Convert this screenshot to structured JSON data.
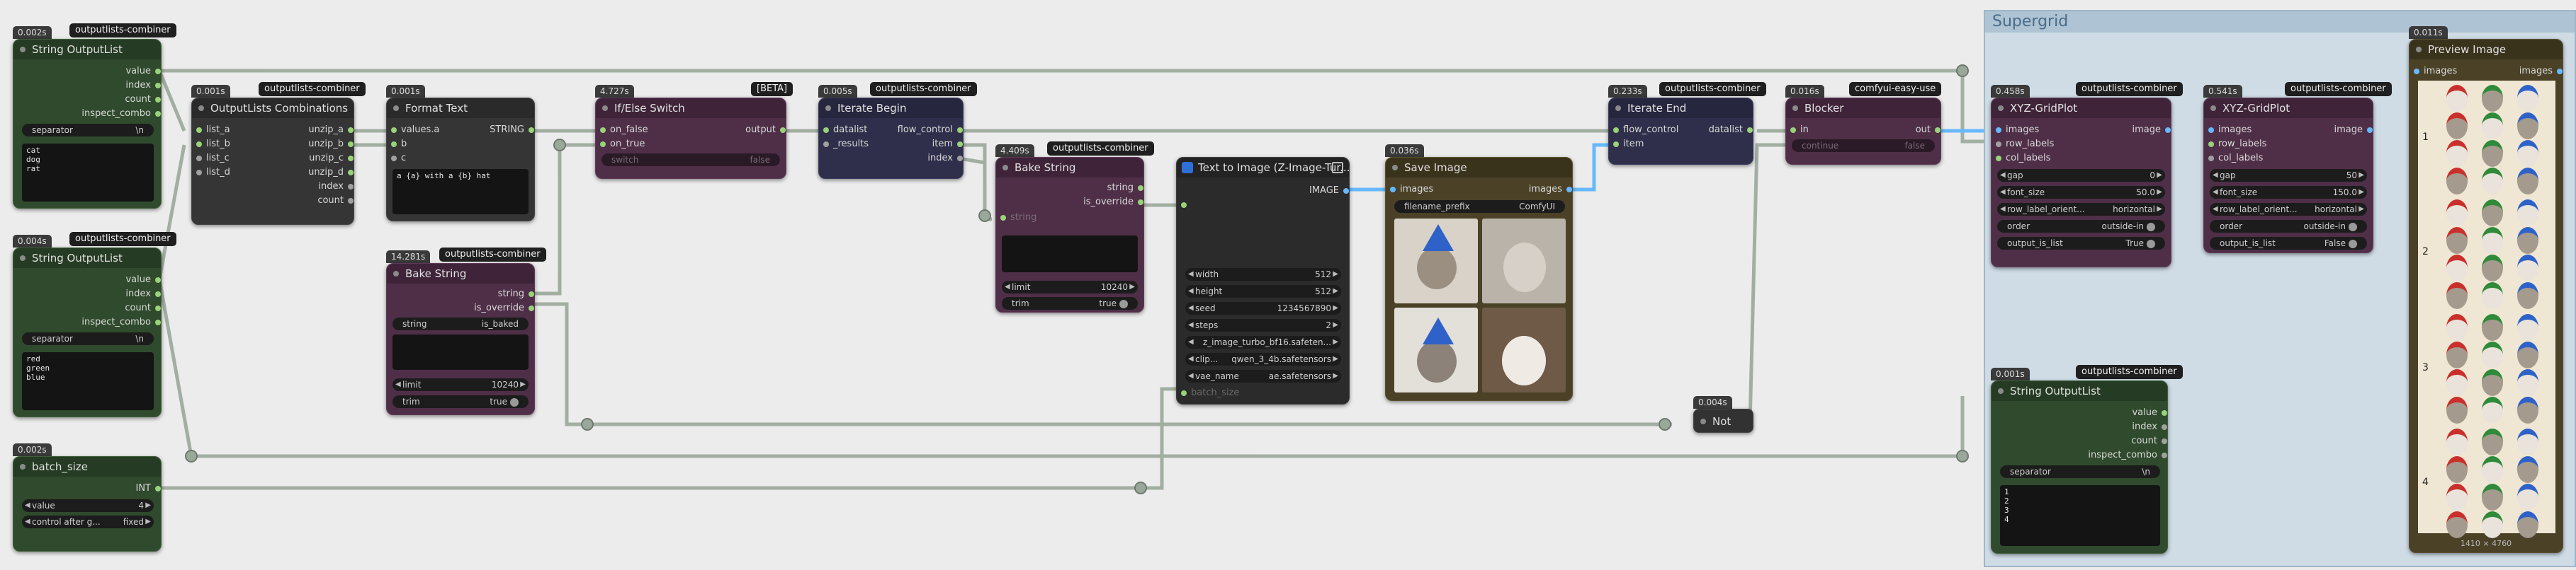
{
  "supergrid": {
    "title": "Supergrid"
  },
  "nodes": {
    "string1": {
      "time": "0.002s",
      "source": "outputlists-combiner",
      "title": "String OutputList",
      "outputs": [
        "value",
        "index",
        "count",
        "inspect_combo"
      ],
      "separator_label": "separator",
      "separator_value": "\\n",
      "text": "cat\ndog\nrat"
    },
    "string2": {
      "time": "0.004s",
      "source": "outputlists-combiner",
      "title": "String OutputList",
      "outputs": [
        "value",
        "index",
        "count",
        "inspect_combo"
      ],
      "separator_label": "separator",
      "separator_value": "\\n",
      "text": "red\ngreen\nblue"
    },
    "batch": {
      "time": "0.002s",
      "title": "batch_size",
      "output": "INT",
      "value_label": "value",
      "value": "4",
      "control_label": "control after g...",
      "control_value": "fixed"
    },
    "combos": {
      "time": "0.001s",
      "source": "outputlists-combiner",
      "title": "OutputLists Combinations",
      "inputs": [
        "list_a",
        "list_b",
        "list_c",
        "list_d"
      ],
      "outputs": [
        "unzip_a",
        "unzip_b",
        "unzip_c",
        "unzip_d",
        "index",
        "count"
      ]
    },
    "format": {
      "time": "0.001s",
      "title": "Format Text",
      "inputs": [
        "values.a",
        "b",
        "c"
      ],
      "output": "STRING",
      "template": "a {a} with a {b} hat"
    },
    "bake1": {
      "time": "14.281s",
      "source": "outputlists-combiner",
      "title": "Bake String",
      "outputs": [
        "string",
        "is_override"
      ],
      "string_label": "string",
      "string_value": "is_baked",
      "limit_label": "limit",
      "limit_value": "10240",
      "trim_label": "trim",
      "trim_value": "true"
    },
    "ifelse": {
      "time": "4.727s",
      "source": "[BETA]",
      "title": "If/Else Switch",
      "inputs": [
        "on_false",
        "on_true",
        "switch"
      ],
      "output": "output",
      "switch_value": "false"
    },
    "iterbegin": {
      "time": "0.005s",
      "source": "outputlists-combiner",
      "title": "Iterate Begin",
      "inputs": [
        "datalist",
        "_results"
      ],
      "outputs": [
        "flow_control",
        "item",
        "index"
      ]
    },
    "bake2": {
      "time": "4.409s",
      "source": "outputlists-combiner",
      "title": "Bake String",
      "outputs": [
        "string",
        "is_override"
      ],
      "string_label": "string",
      "limit_label": "limit",
      "limit_value": "10240",
      "trim_label": "trim",
      "trim_value": "true"
    },
    "t2i": {
      "title": "Text to Image (Z-Image-Tur...",
      "output": "IMAGE",
      "fields": [
        {
          "label": "width",
          "value": "512"
        },
        {
          "label": "height",
          "value": "512"
        },
        {
          "label": "seed",
          "value": "1234567890"
        },
        {
          "label": "steps",
          "value": "2"
        },
        {
          "label": "",
          "value": "z_image_turbo_bf16.safeten..."
        },
        {
          "label": "clip...",
          "value": "qwen_3_4b.safetensors"
        },
        {
          "label": "vae_name",
          "value": "ae.safetensors"
        }
      ],
      "batch_label": "batch_size"
    },
    "save": {
      "time": "0.036s",
      "title": "Save Image",
      "input": "images",
      "output": "images",
      "prefix_label": "filename_prefix",
      "prefix_value": "ComfyUI"
    },
    "not": {
      "time": "0.004s",
      "title": "Not"
    },
    "iterend": {
      "time": "0.233s",
      "source": "outputlists-combiner",
      "title": "Iterate End",
      "inputs": [
        "flow_control",
        "item"
      ],
      "output": "datalist"
    },
    "blocker": {
      "time": "0.016s",
      "source": "comfyui-easy-use",
      "title": "Blocker",
      "input": "in",
      "output": "out",
      "continue_label": "continue",
      "continue_value": "false"
    },
    "xyz1": {
      "time": "0.458s",
      "source": "outputlists-combiner",
      "title": "XYZ-GridPlot",
      "inputs": [
        "images",
        "row_labels",
        "col_labels"
      ],
      "output": "image",
      "fields": [
        {
          "label": "gap",
          "value": "0"
        },
        {
          "label": "font_size",
          "value": "50.0"
        },
        {
          "label": "row_label_orient...",
          "value": "horizontal"
        },
        {
          "label": "order",
          "value": "outside-in"
        },
        {
          "label": "output_is_list",
          "value": "True"
        }
      ]
    },
    "xyz2": {
      "time": "0.541s",
      "source": "outputlists-combiner",
      "title": "XYZ-GridPlot",
      "inputs": [
        "images",
        "row_labels",
        "col_labels"
      ],
      "output": "image",
      "fields": [
        {
          "label": "gap",
          "value": "50"
        },
        {
          "label": "font_size",
          "value": "150.0"
        },
        {
          "label": "row_label_orient...",
          "value": "horizontal"
        },
        {
          "label": "order",
          "value": "outside-in"
        },
        {
          "label": "output_is_list",
          "value": "False"
        }
      ]
    },
    "string3": {
      "time": "0.001s",
      "source": "outputlists-combiner",
      "title": "String OutputList",
      "outputs": [
        "value",
        "index",
        "count",
        "inspect_combo"
      ],
      "separator_label": "separator",
      "separator_value": "\\n",
      "text": "1\n2\n3\n4"
    },
    "preview": {
      "time": "0.011s",
      "title": "Preview Image",
      "input": "images",
      "output": "images",
      "row_labels": [
        "1",
        "2",
        "3",
        "4"
      ],
      "size": "1410 × 4760"
    }
  },
  "colors": {
    "canvas": "#ececec",
    "wire": "#9aa89a",
    "image_wire": "#67b8ff",
    "green_node": "#2f4a2c",
    "purple_node": "#4f2f48",
    "navy_node": "#2f2f4b",
    "brown_node": "#4a4127"
  }
}
